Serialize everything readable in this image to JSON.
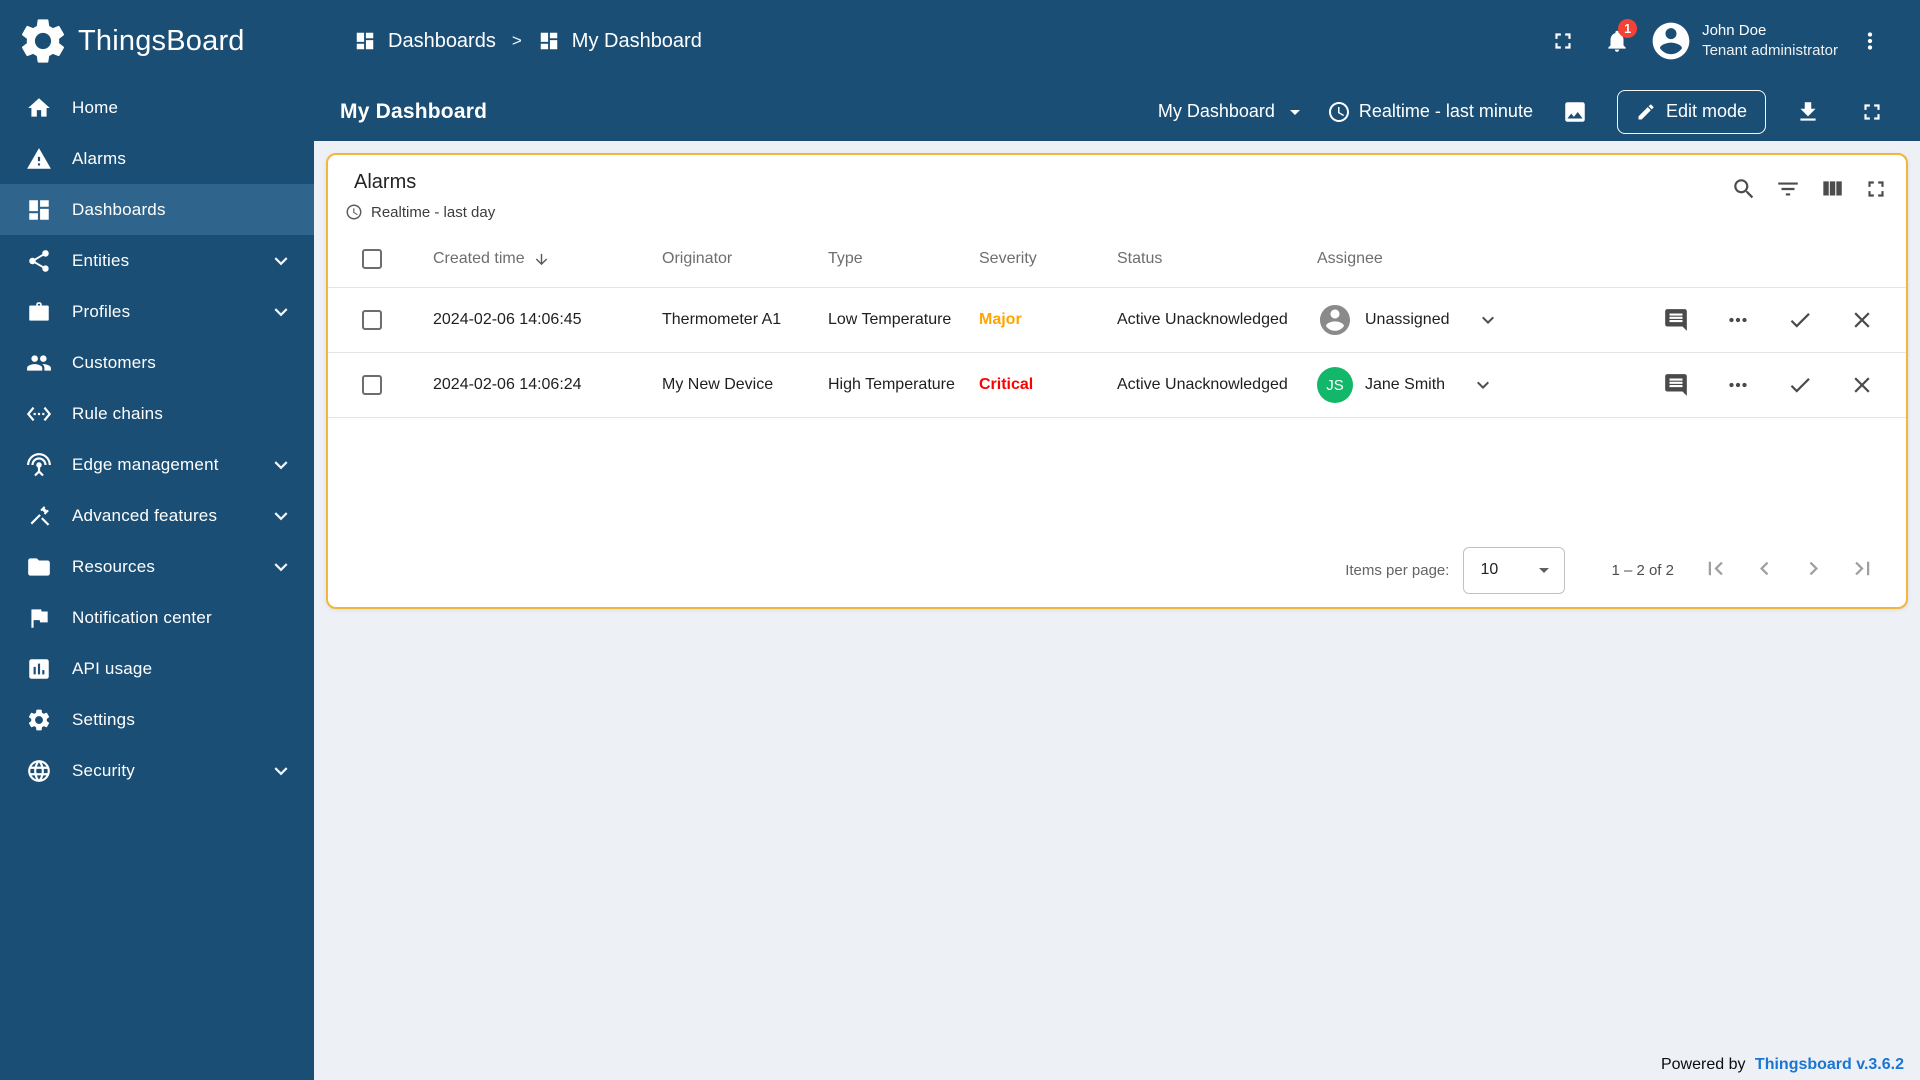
{
  "app": {
    "name": "ThingsBoard",
    "footer": {
      "powered_by": "Powered by",
      "version": "Thingsboard v.3.6.2"
    }
  },
  "colors": {
    "sidebar_bg": "#1a4e75",
    "sidebar_active": "#2f658c",
    "content_bg": "#edf0f5",
    "widget_border": "#f2b53d",
    "badge": "#f44336",
    "link": "#1976d2"
  },
  "header": {
    "breadcrumb": {
      "parent": "Dashboards",
      "separator": ">",
      "current": "My Dashboard"
    },
    "notifications": {
      "count": "1"
    },
    "user": {
      "name": "John Doe",
      "role": "Tenant administrator"
    }
  },
  "sidebar": {
    "items": [
      {
        "label": "Home",
        "icon": "home-icon",
        "active": false,
        "expandable": false
      },
      {
        "label": "Alarms",
        "icon": "warning-icon",
        "active": false,
        "expandable": false
      },
      {
        "label": "Dashboards",
        "icon": "dashboards-icon",
        "active": true,
        "expandable": false
      },
      {
        "label": "Entities",
        "icon": "entities-icon",
        "active": false,
        "expandable": true
      },
      {
        "label": "Profiles",
        "icon": "profiles-icon",
        "active": false,
        "expandable": true
      },
      {
        "label": "Customers",
        "icon": "customers-icon",
        "active": false,
        "expandable": false
      },
      {
        "label": "Rule chains",
        "icon": "rule-chains-icon",
        "active": false,
        "expandable": false
      },
      {
        "label": "Edge management",
        "icon": "edge-icon",
        "active": false,
        "expandable": true
      },
      {
        "label": "Advanced features",
        "icon": "advanced-icon",
        "active": false,
        "expandable": true
      },
      {
        "label": "Resources",
        "icon": "resources-icon",
        "active": false,
        "expandable": true
      },
      {
        "label": "Notification center",
        "icon": "notification-icon",
        "active": false,
        "expandable": false
      },
      {
        "label": "API usage",
        "icon": "api-icon",
        "active": false,
        "expandable": false
      },
      {
        "label": "Settings",
        "icon": "settings-icon",
        "active": false,
        "expandable": false
      },
      {
        "label": "Security",
        "icon": "security-icon",
        "active": false,
        "expandable": true
      }
    ]
  },
  "toolbar": {
    "title": "My Dashboard",
    "dashboard_select": "My Dashboard",
    "timewindow": "Realtime - last minute",
    "edit_button": "Edit mode"
  },
  "widget": {
    "title": "Alarms",
    "subtitle": "Realtime - last day",
    "columns": {
      "created": "Created time",
      "originator": "Originator",
      "type": "Type",
      "severity": "Severity",
      "status": "Status",
      "assignee": "Assignee"
    },
    "rows": [
      {
        "created": "2024-02-06 14:06:45",
        "originator": "Thermometer A1",
        "type": "Low Temperature",
        "severity": "Major",
        "severity_color": "#ffa500",
        "status": "Active Unacknowledged",
        "assignee": {
          "name": "Unassigned",
          "initials": "",
          "color": ""
        }
      },
      {
        "created": "2024-02-06 14:06:24",
        "originator": "My New Device",
        "type": "High Temperature",
        "severity": "Critical",
        "severity_color": "#ff0000",
        "status": "Active Unacknowledged",
        "assignee": {
          "name": "Jane Smith",
          "initials": "JS",
          "color": "#12b76a"
        }
      }
    ],
    "pagination": {
      "label": "Items per page:",
      "page_size": "10",
      "range": "1 – 2 of 2"
    }
  }
}
